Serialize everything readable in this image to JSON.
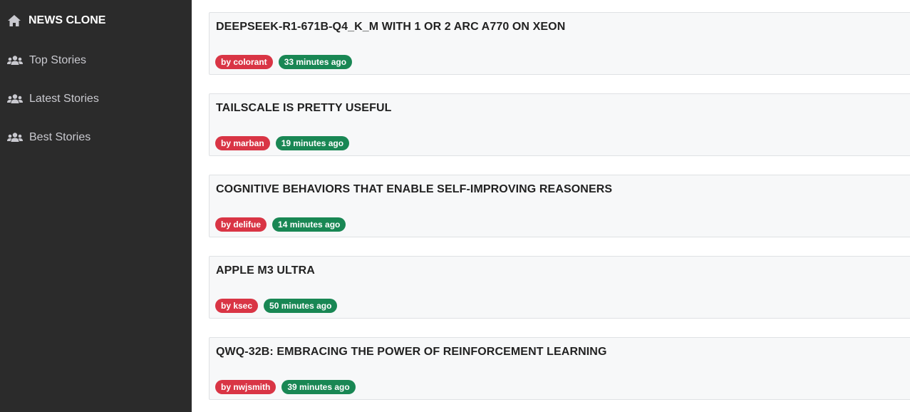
{
  "sidebar": {
    "brand": {
      "icon": "home-icon",
      "label": "NEWS CLONE"
    },
    "items": [
      {
        "icon": "users-icon",
        "label": "Top Stories"
      },
      {
        "icon": "users-icon",
        "label": "Latest Stories"
      },
      {
        "icon": "users-icon",
        "label": "Best Stories"
      }
    ]
  },
  "colors": {
    "sidebar_bg": "#2b2b2b",
    "author_badge": "#d93545",
    "time_badge": "#198754",
    "card_bg": "#f7f8f9"
  },
  "stories": [
    {
      "title": "DEEPSEEK-R1-671B-Q4_K_M WITH 1 OR 2 ARC A770 ON XEON",
      "author": "by colorant",
      "time": "33 minutes ago"
    },
    {
      "title": "TAILSCALE IS PRETTY USEFUL",
      "author": "by marban",
      "time": "19 minutes ago"
    },
    {
      "title": "COGNITIVE BEHAVIORS THAT ENABLE SELF-IMPROVING REASONERS",
      "author": "by delifue",
      "time": "14 minutes ago"
    },
    {
      "title": "APPLE M3 ULTRA",
      "author": "by ksec",
      "time": "50 minutes ago"
    },
    {
      "title": "QWQ-32B: EMBRACING THE POWER OF REINFORCEMENT LEARNING",
      "author": "by nwjsmith",
      "time": "39 minutes ago"
    }
  ]
}
